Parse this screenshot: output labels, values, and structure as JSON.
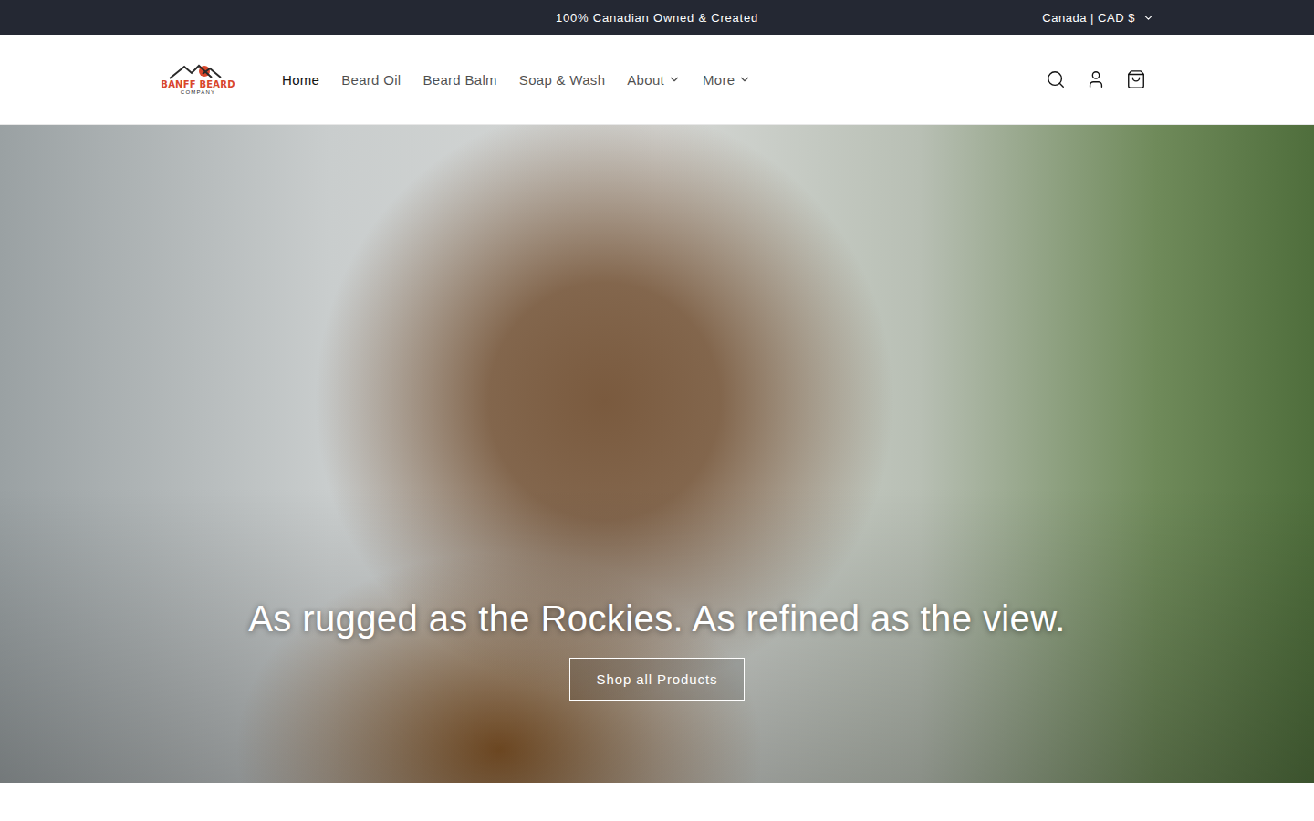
{
  "announcement": {
    "text": "100% Canadian Owned & Created"
  },
  "locale": {
    "label": "Canada | CAD $"
  },
  "logo": {
    "title": "BANFF BEARD",
    "subtitle": "COMPANY"
  },
  "nav": [
    {
      "label": "Home",
      "selected": true,
      "dropdown": false
    },
    {
      "label": "Beard Oil",
      "selected": false,
      "dropdown": false
    },
    {
      "label": "Beard Balm",
      "selected": false,
      "dropdown": false
    },
    {
      "label": "Soap & Wash",
      "selected": false,
      "dropdown": false
    },
    {
      "label": "About",
      "selected": false,
      "dropdown": true
    },
    {
      "label": "More",
      "selected": false,
      "dropdown": true
    }
  ],
  "hero": {
    "heading": "As rugged as the Rockies. As refined as the view.",
    "button": "Shop all Products"
  }
}
